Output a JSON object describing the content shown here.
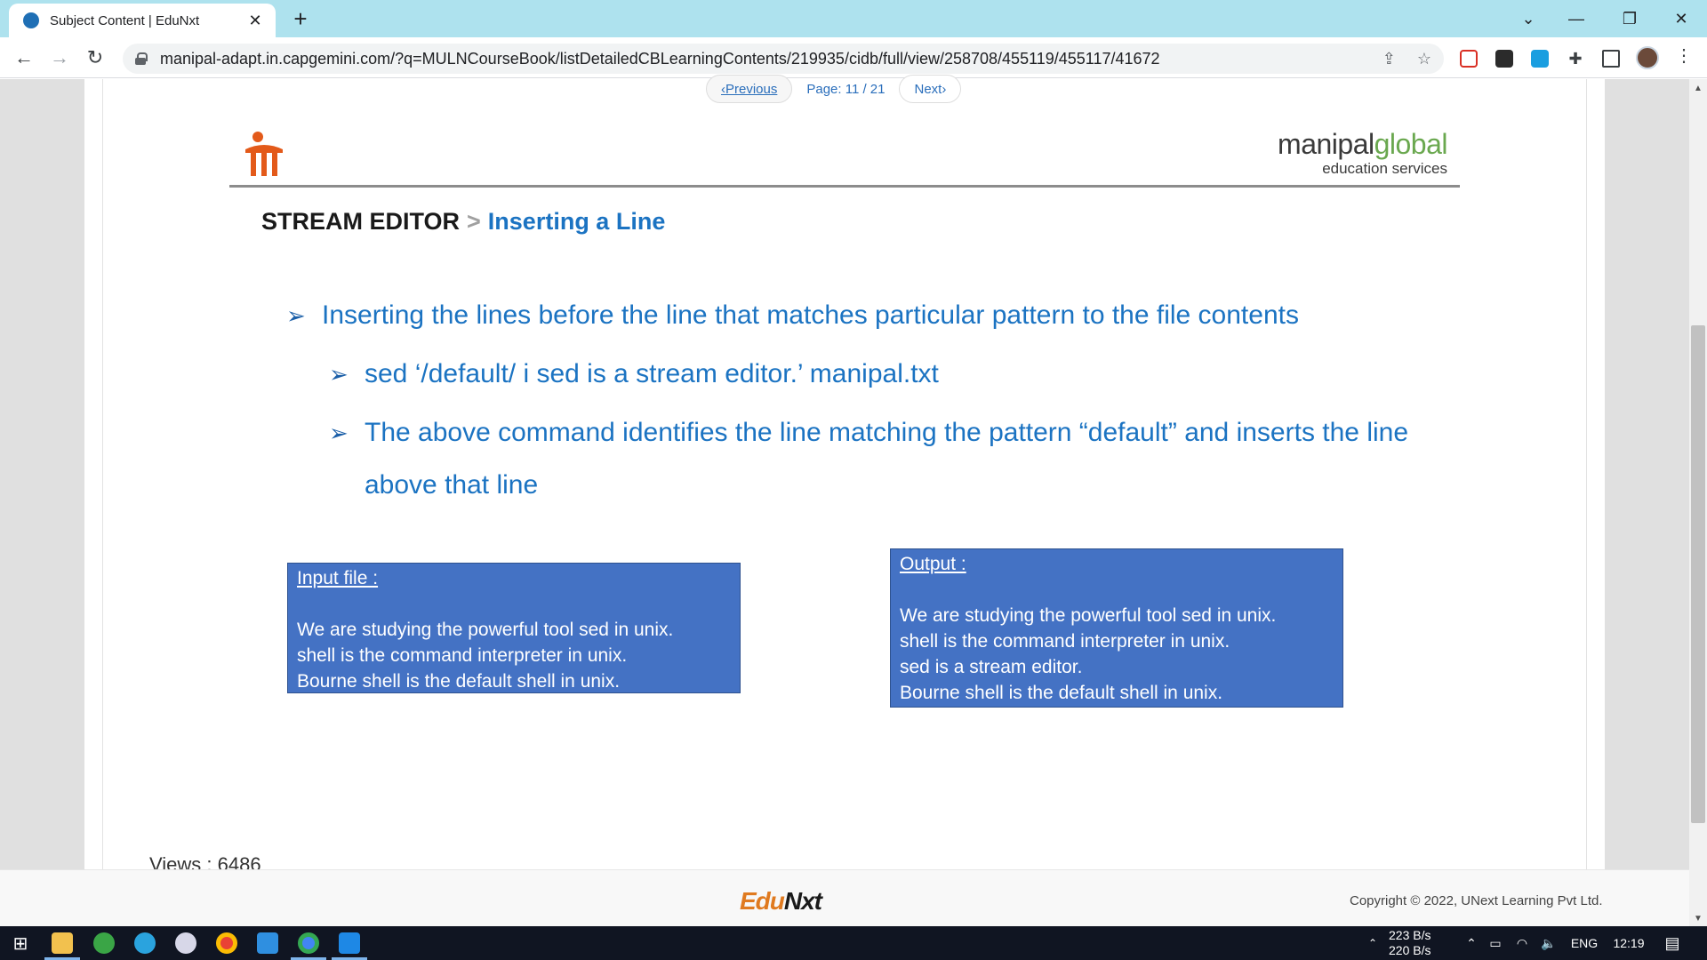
{
  "browser": {
    "tab_title": "Subject Content | EduNxt",
    "new_tab": "+",
    "url": "manipal-adapt.in.capgemini.com/?q=MULNCourseBook/listDetailedCBLearningContents/219935/cidb/full/view/258708/455119/455117/41672",
    "icons": [
      "back-icon",
      "forward-icon",
      "reload-icon",
      "lock-icon",
      "share-icon",
      "bookmark-star-icon",
      "extensions-icon",
      "side-panel-icon",
      "profile-avatar",
      "menu-icon"
    ]
  },
  "pager": {
    "previous": "‹Previous",
    "page_label": "Page: 11 / 21",
    "next": "Next›"
  },
  "slide": {
    "brand_main_a": "manipal",
    "brand_main_b": "global",
    "brand_sub": "education services",
    "heading_main": "STREAM EDITOR",
    "heading_sep": ">",
    "heading_sub": "Inserting a Line",
    "bullets": [
      "Inserting the lines before the line that matches particular pattern to the file contents",
      "sed  ‘/default/ i sed is a stream editor.’ manipal.txt",
      "The above command identifies the line matching the pattern “default” and inserts the line",
      "above that line"
    ],
    "input_box": {
      "title": "Input file :",
      "lines": [
        "We are studying the powerful tool sed in unix.",
        "shell is the command interpreter in unix.",
        "Bourne shell is the default shell in unix."
      ]
    },
    "output_box": {
      "title": "Output :",
      "lines": [
        "We are studying the powerful tool sed in unix.",
        "shell is the command interpreter in unix.",
        "sed is a stream editor.",
        "Bourne shell is the default shell in unix."
      ]
    }
  },
  "views": "Views :   6486",
  "footer": {
    "logo_a": "Edu",
    "logo_b": "Nxt",
    "copyright": "Copyright © 2022, UNext Learning Pvt Ltd."
  },
  "taskbar": {
    "net_up": "223 B/s",
    "net_down": "220 B/s",
    "lang": "ENG",
    "time": "12:19"
  },
  "colors": {
    "tabbar": "#aee2ee",
    "slide_blue": "#1b73c2",
    "box_blue": "#4472c4",
    "brand_green": "#6aa84f",
    "edunxt_orange": "#e07a1f"
  }
}
